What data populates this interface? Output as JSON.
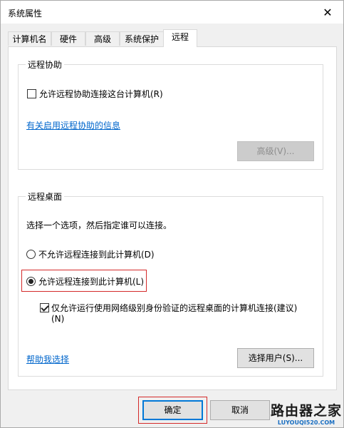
{
  "window": {
    "title": "系统属性",
    "close_glyph": "✕"
  },
  "tabs": [
    {
      "label": "计算机名",
      "active": false
    },
    {
      "label": "硬件",
      "active": false
    },
    {
      "label": "高级",
      "active": false
    },
    {
      "label": "系统保护",
      "active": false
    },
    {
      "label": "远程",
      "active": true
    }
  ],
  "remote_assistance": {
    "group_label": "远程协助",
    "allow_checkbox_label": "允许远程协助连接这台计算机(R)",
    "allow_checked": false,
    "info_link": "有关启用远程协助的信息",
    "advanced_button": "高级(V)..."
  },
  "remote_desktop": {
    "group_label": "远程桌面",
    "instruction": "选择一个选项，然后指定谁可以连接。",
    "option_deny": "不允许远程连接到此计算机(D)",
    "option_allow": "允许远程连接到此计算机(L)",
    "selected": "allow",
    "nla_label_line1": "仅允许运行使用网络级别身份验证的远程桌面的计算机连接(建议)",
    "nla_label_line2": "(N)",
    "nla_checked": true,
    "help_link": "帮助我选择",
    "select_users_button": "选择用户(S)..."
  },
  "footer": {
    "ok": "确定",
    "cancel": "取消"
  },
  "watermark": {
    "main": "路由器之家",
    "url": "LUYOUQI520.COM"
  },
  "colors": {
    "link": "#0066cc",
    "highlight": "#d42a2a",
    "default_button": "#0078d7"
  }
}
